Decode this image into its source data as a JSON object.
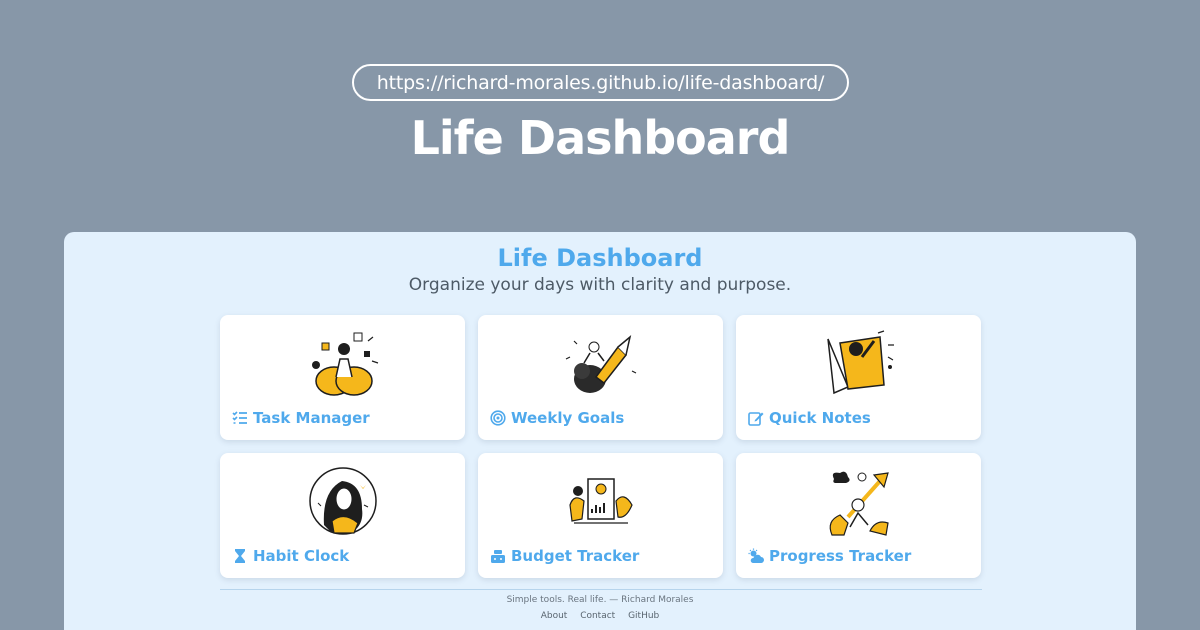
{
  "hero": {
    "url": "https://richard-morales.github.io/life-dashboard/",
    "title": "Life Dashboard"
  },
  "panel": {
    "title": "Life Dashboard",
    "subtitle": "Organize your days with clarity and purpose."
  },
  "cards": [
    {
      "label": "Task Manager",
      "icon": "task-list-icon"
    },
    {
      "label": "Weekly Goals",
      "icon": "target-icon"
    },
    {
      "label": "Quick Notes",
      "icon": "edit-note-icon"
    },
    {
      "label": "Habit Clock",
      "icon": "hourglass-icon"
    },
    {
      "label": "Budget Tracker",
      "icon": "cash-register-icon"
    },
    {
      "label": "Progress Tracker",
      "icon": "cloud-sun-icon"
    }
  ],
  "footer": {
    "text": "Simple tools. Real life. — Richard Morales",
    "links": [
      "About",
      "Contact",
      "GitHub"
    ]
  },
  "colors": {
    "background": "#8797a8",
    "panel": "#e3f1fd",
    "accent_blue": "#4fa9ec",
    "illustration_yellow": "#f5b71b"
  }
}
